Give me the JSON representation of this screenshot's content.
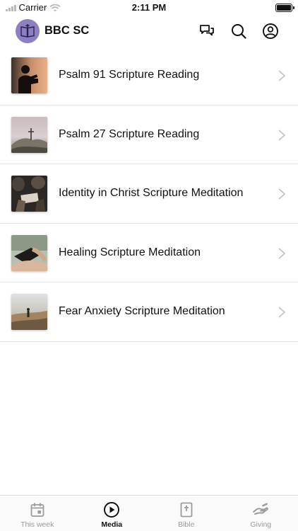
{
  "status_bar": {
    "carrier": "Carrier",
    "time": "2:11 PM"
  },
  "header": {
    "org_name": "BBC SC",
    "icons": [
      "chat-icon",
      "search-icon",
      "profile-icon"
    ],
    "avatar_color": "#8e7fc2"
  },
  "items": [
    {
      "title": "Psalm 91 Scripture Reading",
      "thumbnail": "person-reading-silhouette"
    },
    {
      "title": "Psalm 27 Scripture Reading",
      "thumbnail": "cross-on-mountain"
    },
    {
      "title": "Identity in Christ Scripture Meditation",
      "thumbnail": "group-bible-study"
    },
    {
      "title": "Healing Scripture Meditation",
      "thumbnail": "hands-holding-bible"
    },
    {
      "title": "Fear Anxiety Scripture Meditation",
      "thumbnail": "person-on-hill"
    }
  ],
  "tabs": [
    {
      "label": "This week",
      "icon": "calendar-icon",
      "active": false
    },
    {
      "label": "Media",
      "icon": "play-icon",
      "active": true
    },
    {
      "label": "Bible",
      "icon": "bible-icon",
      "active": false
    },
    {
      "label": "Giving",
      "icon": "giving-hand-icon",
      "active": false
    }
  ],
  "colors": {
    "active_tab": "#111111",
    "inactive_tab": "#9b9b9b",
    "divider": "#e4e4e4"
  }
}
